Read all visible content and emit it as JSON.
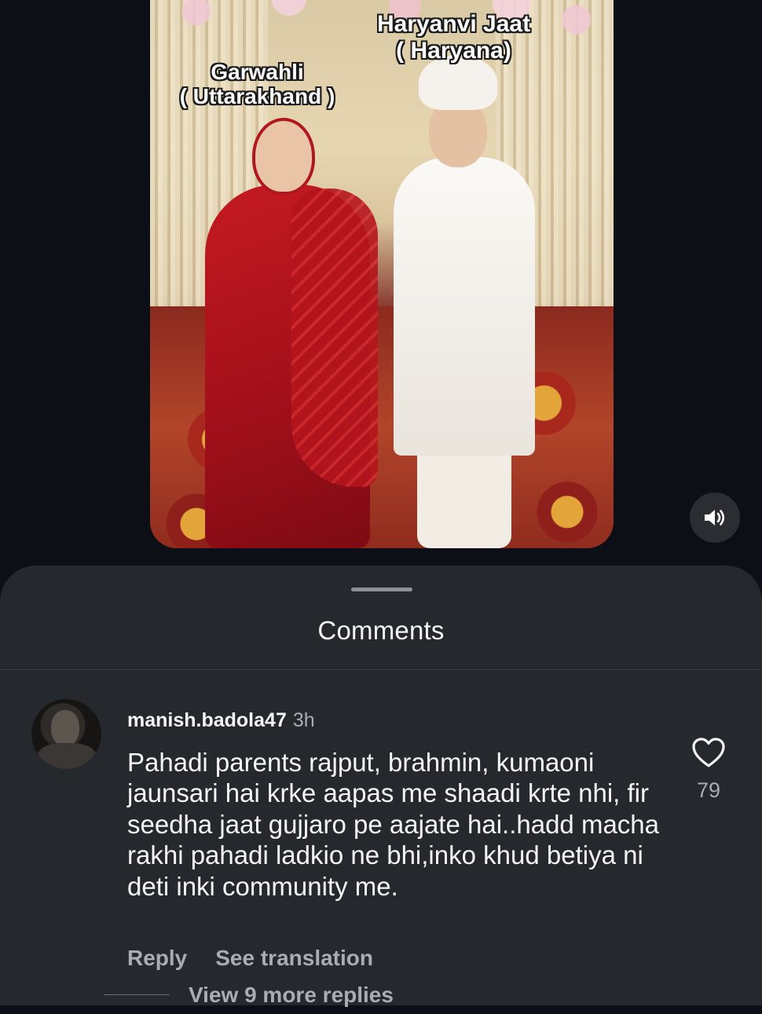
{
  "video": {
    "caption_left": "Garwahli\n( Uttarakhand )",
    "caption_right": "Haryanvi Jaat\n( Haryana)",
    "sound_icon": "speaker-icon"
  },
  "comments_sheet": {
    "title": "Comments",
    "comment": {
      "username": "manish.badola47",
      "time": "3h",
      "text": "Pahadi parents rajput, brahmin, kumaoni jaunsari hai krke aapas me shaadi krte nhi, fir seedha jaat gujjaro pe aajate hai..hadd macha rakhi pahadi ladkio ne bhi,inko khud betiya ni deti inki community me.",
      "likes": "79",
      "reply_label": "Reply",
      "translation_label": "See translation"
    },
    "view_replies_label": "View 9 more replies"
  },
  "colors": {
    "background": "#0c1016",
    "sheet": "#25292e",
    "primary_text": "#f3f5f7",
    "secondary_text": "#a8adb3"
  }
}
